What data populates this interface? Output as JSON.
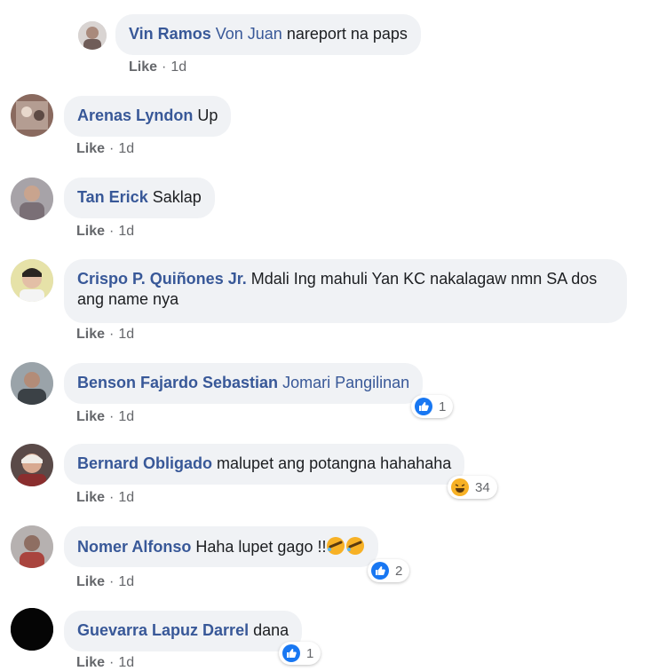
{
  "comments": [
    {
      "author": "Vin Ramos",
      "tag": "Von Juan",
      "text": "nareport na paps",
      "like": "Like",
      "time": "1d"
    },
    {
      "author": "Arenas Lyndon",
      "tag": "",
      "text": "Up",
      "like": "Like",
      "time": "1d"
    },
    {
      "author": "Tan Erick",
      "tag": "",
      "text": "Saklap",
      "like": "Like",
      "time": "1d"
    },
    {
      "author": "Crispo P. Quiñones Jr.",
      "tag": "",
      "text": "Mdali Ing mahuli Yan KC nakalagaw nmn SA dos ang name nya",
      "like": "Like",
      "time": "1d"
    },
    {
      "author": "Benson Fajardo Sebastian",
      "tag": "Jomari Pangilinan",
      "text": "",
      "like": "Like",
      "time": "1d",
      "reaction": {
        "icon": "thumbs-up-icon",
        "count": "1"
      }
    },
    {
      "author": "Bernard Obligado",
      "tag": "",
      "text": "malupet ang potangna hahahaha",
      "like": "Like",
      "time": "1d",
      "reaction": {
        "icon": "haha-icon",
        "count": "34"
      }
    },
    {
      "author": "Nomer Alfonso",
      "tag": "",
      "text": "Haha lupet gago !!",
      "like": "Like",
      "time": "1d",
      "emoji": "rolling-laughing-icon",
      "reaction": {
        "icon": "thumbs-up-icon",
        "count": "2"
      }
    },
    {
      "author": "Guevarra Lapuz Darrel",
      "tag": "",
      "text": "dana",
      "like": "Like",
      "time": "1d",
      "reaction": {
        "icon": "thumbs-up-icon",
        "count": "1"
      }
    }
  ],
  "colors": {
    "author": "#385898",
    "bubble": "#f0f2f5",
    "meta": "#65676b",
    "like_blue": "#1877f2",
    "haha_yellow": "#f7b125"
  }
}
